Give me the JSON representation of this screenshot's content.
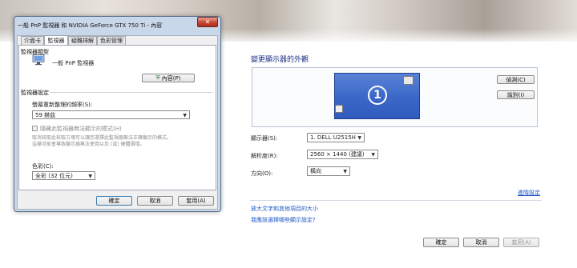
{
  "dialog": {
    "title": "一般 PnP 監視器 和 NVIDIA GeForce GTX 750 Ti - 內容",
    "close_label": "✕",
    "tabs": [
      {
        "label": "介面卡"
      },
      {
        "label": "監視器"
      },
      {
        "label": "疑難排解"
      },
      {
        "label": "色彩管理"
      }
    ],
    "monitor_type_title": "監視器類型",
    "monitor_name": "一般 PnP 監視器",
    "properties_button": "內容(P)",
    "monitor_settings_title": "監視器設定",
    "refresh_rate_label": "螢幕重新整理的頻率(S):",
    "refresh_rate_value": "59 赫茲",
    "hide_modes_label": "隱藏此監視器無法顯示的模式(H)",
    "hide_modes_hint_1": "取消核取此核取方塊可以讓您選擇此監視器無法正確顯示的模式。",
    "hide_modes_hint_2": "這樣可能會導致顯示器無法使用以及 (或) 硬體損壞。",
    "colors_label": "色彩(C):",
    "colors_value": "全彩 (32 位元)",
    "ok_button": "確定",
    "cancel_button": "取消",
    "apply_button": "套用(A)"
  },
  "display_settings": {
    "title": "變更顯示器的外觀",
    "monitor_number": "1",
    "detect_button": "偵測(C)",
    "identify_button": "識別(I)",
    "display_label": "顯示器(S):",
    "display_value": "1. DELL U2515H",
    "resolution_label": "解析度(R):",
    "resolution_value": "2560 × 1440 (建議)",
    "orientation_label": "方向(O):",
    "orientation_value": "橫向",
    "advanced_link": "進階設定",
    "text_size_link": "放大文字和其他項目的大小",
    "which_settings_link": "我應該選擇哪些顯示設定?",
    "ok_button": "確定",
    "cancel_button": "取消",
    "apply_button": "套用(A)"
  },
  "colors": {
    "accent_link": "#1a56c4",
    "monitor_blue": "#3a67c8",
    "close_red": "#c4402a"
  }
}
